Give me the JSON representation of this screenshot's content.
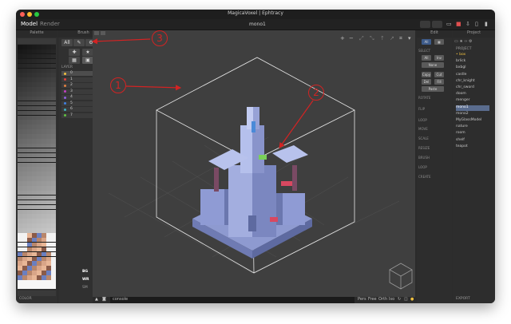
{
  "window": {
    "title": "MagicaVoxel | Ephtracy",
    "filename": "mono1",
    "traffic_lights": {
      "close": "#ff5f57",
      "minimize": "#febc2e",
      "maximize": "#28c840"
    }
  },
  "menubar": {
    "tabs": [
      {
        "label": "Model",
        "active": true
      },
      {
        "label": "Render",
        "active": false
      }
    ]
  },
  "palette": {
    "title": "Palette",
    "footer": "COLOR"
  },
  "brush": {
    "title": "Brush",
    "all_label": "All",
    "layer_header": "LAYER",
    "layers": [
      {
        "index": "0",
        "color": "#f0c040"
      },
      {
        "index": "1",
        "color": "#e04040"
      },
      {
        "index": "2",
        "color": "#e08040"
      },
      {
        "index": "3",
        "color": "#c040c0"
      },
      {
        "index": "4",
        "color": "#9060e0"
      },
      {
        "index": "5",
        "color": "#4080e0"
      },
      {
        "index": "6",
        "color": "#40b0c0"
      },
      {
        "index": "7",
        "color": "#60c040"
      }
    ],
    "bottom": {
      "bg": "BG",
      "wr": "WR",
      "edge": "Edge",
      "grid": "Grid",
      "frame": "Frame",
      "sm": "SM"
    }
  },
  "viewport": {
    "console_placeholder": "console",
    "view_modes": [
      "Pers",
      "Free",
      "Orth",
      "Iso"
    ]
  },
  "edit": {
    "title": "Edit",
    "all_label": "All",
    "select_header": "SELECT",
    "buttons": [
      "All",
      "Inv",
      "None",
      "Copy",
      "Cut",
      "Del",
      "Fill",
      "Paste"
    ],
    "sections": [
      "ROTATE",
      "FLIP",
      "LOOP",
      "MOVE",
      "SCALE",
      "RESIZE",
      "BRUSH",
      "LOOP",
      "CREATE"
    ]
  },
  "project": {
    "title": "Project",
    "section": "PROJECT",
    "items": [
      {
        "name": "box",
        "active": false,
        "highlight": true
      },
      {
        "name": "brlick",
        "active": false
      },
      {
        "name": "bxbgl",
        "active": false
      },
      {
        "name": "castle",
        "active": false
      },
      {
        "name": "chr_knight",
        "active": false
      },
      {
        "name": "chr_sword",
        "active": false
      },
      {
        "name": "doom",
        "active": false
      },
      {
        "name": "menger",
        "active": false
      },
      {
        "name": "mono1",
        "active": true
      },
      {
        "name": "mono2",
        "active": false
      },
      {
        "name": "MyGlassModel",
        "active": false
      },
      {
        "name": "nature",
        "active": false
      },
      {
        "name": "room",
        "active": false
      },
      {
        "name": "shelf",
        "active": false
      },
      {
        "name": "teapot",
        "active": false
      }
    ],
    "footer": "EXPORT"
  },
  "annotations": [
    "1",
    "2",
    "3"
  ],
  "accent_color": "#d32323"
}
